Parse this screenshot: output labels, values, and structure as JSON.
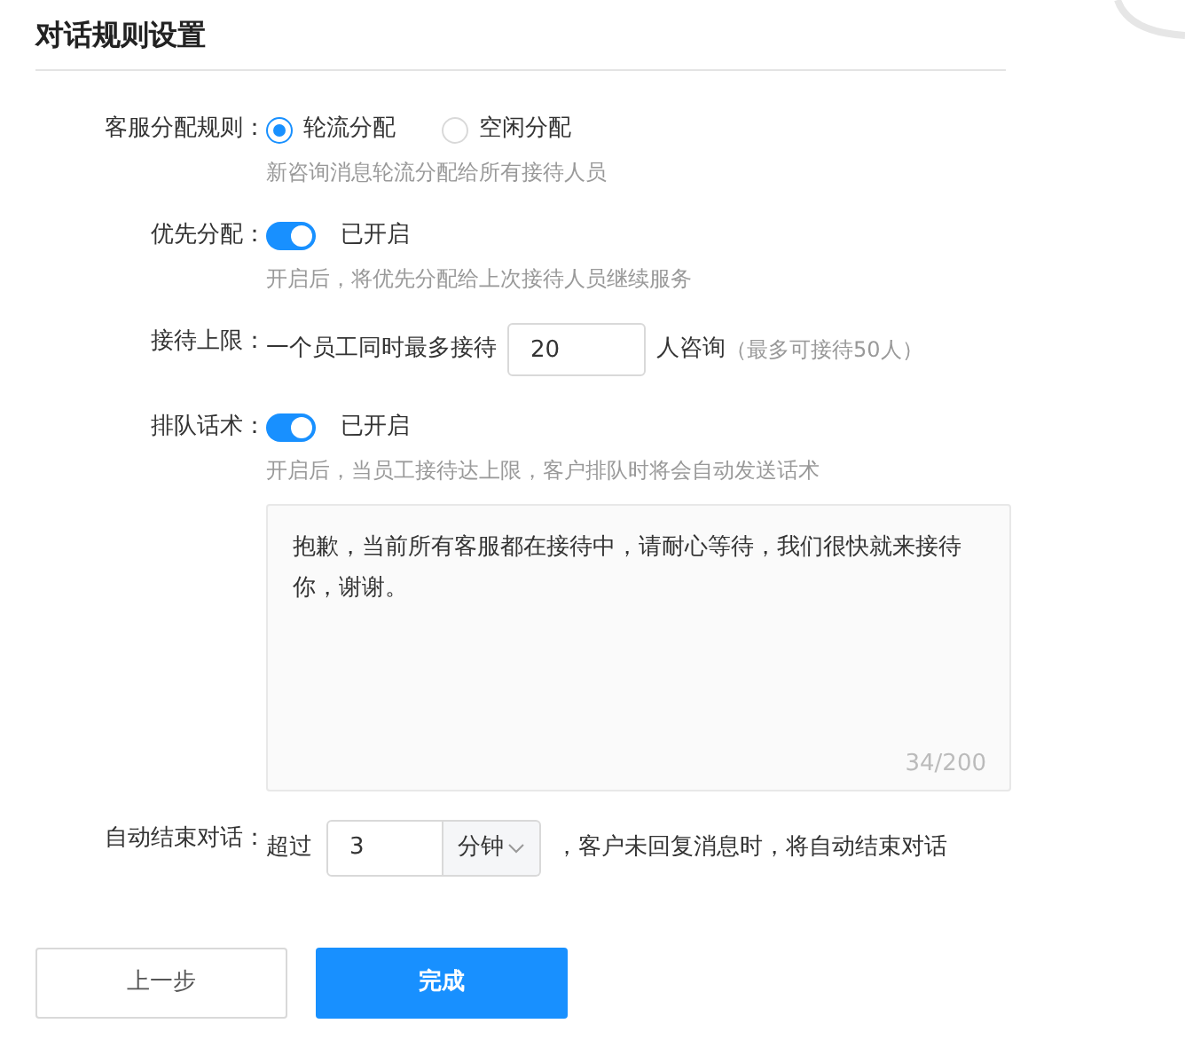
{
  "title": "对话规则设置",
  "fields": [
    {
      "kind": "radio",
      "label": "客服分配规则：",
      "options": [
        {
          "label": "轮流分配",
          "selected": true
        },
        {
          "label": "空闲分配",
          "selected": false
        }
      ],
      "hint": "新咨询消息轮流分配给所有接待人员"
    },
    {
      "kind": "switch",
      "label": "优先分配：",
      "on": true,
      "status": "已开启",
      "hint": "开启后，将优先分配给上次接待人员继续服务"
    },
    {
      "kind": "limit",
      "label": "接待上限：",
      "prefix": "一个员工同时最多接待",
      "value": "20",
      "suffix": "人咨询",
      "note": "（最多可接待50人）"
    },
    {
      "kind": "switch",
      "label": "排队话术：",
      "on": true,
      "status": "已开启",
      "hint": "开启后，当员工接待达上限，客户排队时将会自动发送话术",
      "message": {
        "value": "抱歉，当前所有客服都在接待中，请耐心等待，我们很快就来接待你，谢谢。",
        "counter": "34/200"
      }
    },
    {
      "kind": "timeout",
      "label": "自动结束对话：",
      "prefix": "超过",
      "value": "3",
      "unit": "分钟",
      "suffix": "，客户未回复消息时，将自动结束对话"
    }
  ],
  "buttons": [
    {
      "label": "上一步",
      "kind": "secondary"
    },
    {
      "label": "完成",
      "kind": "primary"
    }
  ]
}
